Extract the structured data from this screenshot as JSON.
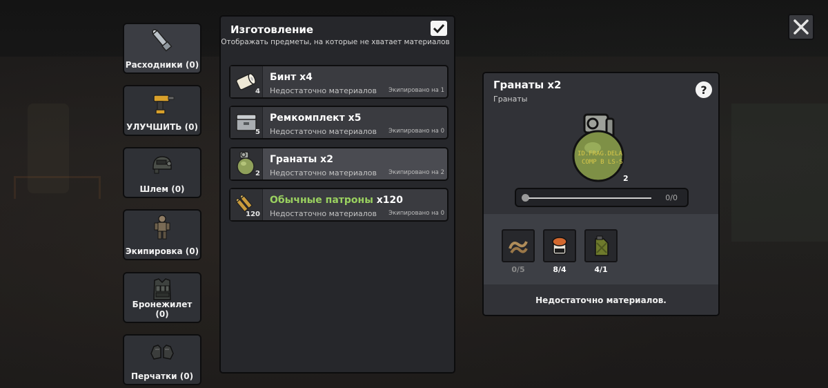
{
  "categories": [
    {
      "label": "Расходники (0)",
      "icon": "ammo-cartridge-icon",
      "active": true
    },
    {
      "label": "УЛУЧШИТЬ (0)",
      "icon": "drill-icon"
    },
    {
      "label": "Шлем (0)",
      "icon": "helmet-icon"
    },
    {
      "label": "Экипировка (0)",
      "icon": "soldier-gear-icon"
    },
    {
      "label": "Бронежилет (0)",
      "icon": "armor-vest-icon"
    },
    {
      "label": "Перчатки (0)",
      "icon": "gloves-icon"
    }
  ],
  "crafting": {
    "title": "Изготовление",
    "subtitle": "Отображать предметы, на которые не хватает материалов",
    "show_unavailable_checked": true,
    "items": [
      {
        "name": "Бинт x4",
        "status": "Недостаточно материалов",
        "equipped": "Экипировано на 1",
        "qty": "4",
        "icon": "bandage-icon"
      },
      {
        "name": "Ремкомплект x5",
        "status": "Недостаточно материалов",
        "equipped": "Экипировано на 0",
        "qty": "5",
        "icon": "repair-kit-icon"
      },
      {
        "name": "Гранаты x2",
        "status": "Недостаточно материалов",
        "equipped": "Экипировано на 2",
        "qty": "2",
        "icon": "grenade-icon",
        "selected": true
      },
      {
        "name_highlight": "Обычные патроны",
        "name_suffix": " x120",
        "status": "Недостаточно материалов",
        "equipped": "Экипировано на 0",
        "qty": "120",
        "icon": "bullets-icon"
      }
    ]
  },
  "detail": {
    "title": "Гранаты x2",
    "category": "Гранаты",
    "image_qty": "2",
    "slider_value": "0/0",
    "materials": [
      {
        "value": "0/5",
        "icon": "wire-coil-icon",
        "color": "#8a8a8a"
      },
      {
        "value": "8/4",
        "icon": "powder-jar-icon",
        "color": "#ffffff"
      },
      {
        "value": "4/1",
        "icon": "fuel-can-icon",
        "color": "#ffffff"
      }
    ],
    "warning": "Недостаточно материалов.",
    "help_label": "?"
  },
  "colors": {
    "highlight_green": "#9ad160",
    "panel_bg": "#26272b",
    "row_bg": "#3a3b40"
  }
}
